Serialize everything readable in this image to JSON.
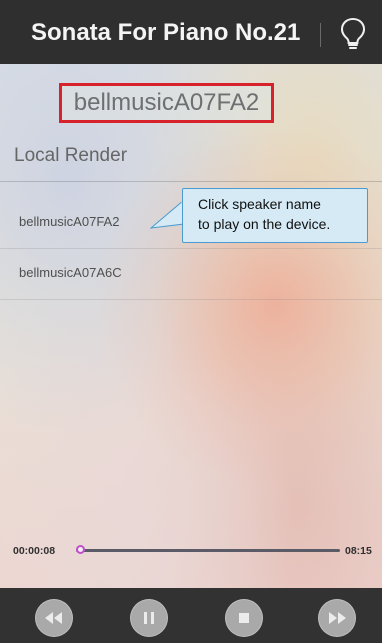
{
  "header": {
    "title": "Sonata For Piano No.21",
    "bulb_icon": "lightbulb-icon"
  },
  "selected_device": "bellmusicA07FA2",
  "section_title": "Local Render",
  "devices": [
    {
      "name": "bellmusicA07FA2"
    },
    {
      "name": "bellmusicA07A6C"
    }
  ],
  "callout": {
    "line1": "Click speaker name",
    "line2": "to play on the device."
  },
  "player": {
    "elapsed": "00:00:08",
    "duration": "08:15",
    "progress_fraction": 0.016
  },
  "controls": {
    "rewind_icon": "rewind-icon",
    "pause_icon": "pause-icon",
    "stop_icon": "stop-icon",
    "forward_icon": "fast-forward-icon"
  },
  "colors": {
    "header_bg": "#2f2f2f",
    "highlight_border": "#d7222b",
    "callout_bg": "#d5eaf5",
    "callout_border": "#4a9bd0",
    "progress_accent": "#c86bd0",
    "controls_bg": "#323232"
  }
}
